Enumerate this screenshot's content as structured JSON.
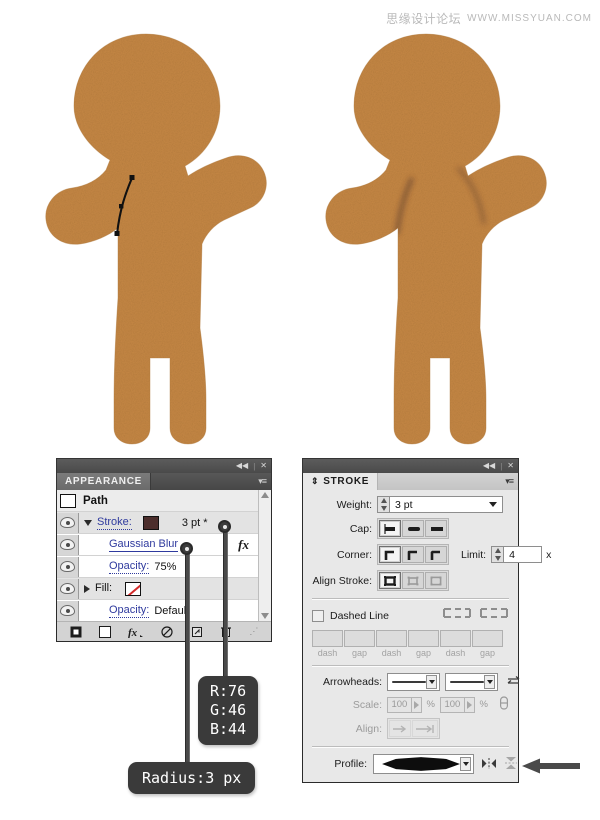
{
  "watermark": {
    "cn": "思缘设计论坛",
    "url": "WWW.MISSYUAN.COM"
  },
  "illustration": {
    "left_figure_name": "gingerbread-man-with-path",
    "right_figure_name": "gingerbread-man-with-shading",
    "cookie_color": "#c58744",
    "path_color": "#111111"
  },
  "appearance_panel": {
    "tab_label": "APPEARANCE",
    "collapse_icon": "◀◀",
    "close_icon": "✕",
    "menu_icon": "▾≡",
    "object_row": {
      "label": "Path",
      "swatch": "none"
    },
    "rows": [
      {
        "label": "Stroke:",
        "value": "3 pt *",
        "swatch_color": "#4C2E2C",
        "disclosure": "down",
        "visible": true,
        "indent": 0,
        "shaded": true
      },
      {
        "label": "Gaussian Blur",
        "value": "",
        "fx": "fx",
        "visible": true,
        "indent": 1,
        "shaded": false
      },
      {
        "label": "Opacity:",
        "value": "75%",
        "visible": true,
        "indent": 1,
        "shaded": false
      },
      {
        "label": "Fill:",
        "value": "",
        "swatch_color": "none",
        "disclosure": "right",
        "visible": true,
        "indent": 0,
        "shaded": true
      },
      {
        "label": "Opacity:",
        "value": "Default",
        "visible": true,
        "indent": 1,
        "shaded": false
      }
    ],
    "footer_icons": [
      "add-new-stroke",
      "add-new-fill",
      "add-new-effect",
      "clear-appearance",
      "duplicate-item",
      "delete-item"
    ]
  },
  "stroke_panel": {
    "tab_label": "STROKE",
    "collapse_icon": "◀◀",
    "close_icon": "✕",
    "menu_icon": "▾≡",
    "weight": {
      "label": "Weight:",
      "value": "3 pt"
    },
    "cap": {
      "label": "Cap:",
      "options": [
        "butt-cap",
        "round-cap",
        "projecting-cap"
      ],
      "selected": 0
    },
    "corner": {
      "label": "Corner:",
      "options": [
        "miter-join",
        "round-join",
        "bevel-join"
      ],
      "selected": 0
    },
    "limit": {
      "label": "Limit:",
      "value": "4",
      "unit": "x"
    },
    "align_stroke": {
      "label": "Align Stroke:",
      "options": [
        "align-center",
        "align-inside",
        "align-outside"
      ],
      "selected": 0
    },
    "dashed_line": {
      "label": "Dashed Line",
      "checked": false,
      "preserve_icon": "dash-preserve-exact",
      "adjust_icon": "dash-adjust-to-fit"
    },
    "dash_fields": [
      {
        "value": "",
        "caption": "dash"
      },
      {
        "value": "",
        "caption": "gap"
      },
      {
        "value": "",
        "caption": "dash"
      },
      {
        "value": "",
        "caption": "gap"
      },
      {
        "value": "",
        "caption": "dash"
      },
      {
        "value": "",
        "caption": "gap"
      }
    ],
    "arrowheads": {
      "label": "Arrowheads:",
      "start_value": "None",
      "end_value": "None",
      "swap_icon": "swap-arrowheads"
    },
    "scale": {
      "label": "Scale:",
      "start_value": "100",
      "end_value": "100",
      "unit": "%",
      "link_icon": "link-scales",
      "disabled": true
    },
    "align_arrowheads": {
      "label": "Align:",
      "options": [
        "extend-beyond-end",
        "place-at-end"
      ],
      "disabled": true
    },
    "profile": {
      "label": "Profile:",
      "value": "Width Profile 1",
      "flip_across_icon": "flip-across",
      "flip_along_icon": "flip-along"
    }
  },
  "callouts": {
    "rgb": {
      "r": "R:76",
      "g": "G:46",
      "b": "B:44"
    },
    "radius": {
      "text": "Radius:3 px"
    },
    "pointer_icon": "left-arrow-pointer"
  }
}
